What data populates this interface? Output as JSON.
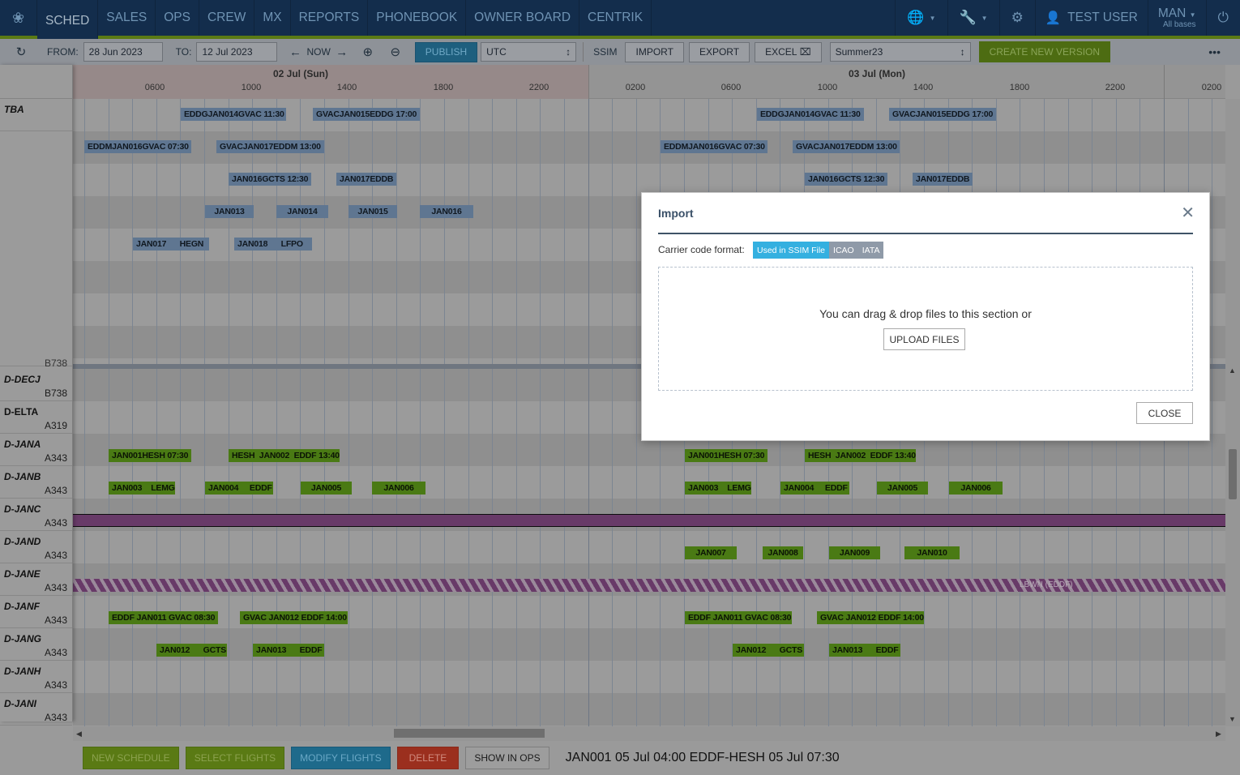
{
  "nav": {
    "items": [
      {
        "label": "SCHED",
        "active": true
      },
      {
        "label": "SALES"
      },
      {
        "label": "OPS"
      },
      {
        "label": "CREW"
      },
      {
        "label": "MX"
      },
      {
        "label": "REPORTS"
      },
      {
        "label": "PHONEBOOK"
      },
      {
        "label": "OWNER BOARD"
      },
      {
        "label": "CENTRIK"
      }
    ],
    "user": "TEST USER",
    "base": "MAN",
    "base_sub": "All bases",
    "icons": {
      "logo": "paw-icon",
      "globe": "globe-icon",
      "tools": "wrench-icon",
      "settings": "gear-icon",
      "user": "user-icon",
      "power": "power-icon"
    }
  },
  "toolbar": {
    "from_label": "FROM:",
    "from_value": "28 Jun 2023",
    "to_label": "TO:",
    "to_value": "12 Jul 2023",
    "now_label": "NOW",
    "publish_label": "PUBLISH",
    "timezone": "UTC",
    "ssim_label": "SSIM",
    "import_label": "IMPORT",
    "export_label": "EXPORT",
    "excel_label": "EXCEL",
    "version": "Summer23",
    "create_version_label": "CREATE NEW VERSION",
    "more_label": "•••"
  },
  "timeline": {
    "days": [
      "02 Jul (Sun)",
      "03 Jul (Mon)"
    ],
    "day1_ticks": [
      "0600",
      "1000",
      "1400",
      "1800",
      "2200"
    ],
    "day2_ticks": [
      "0200",
      "0600",
      "1000",
      "1400",
      "1800",
      "2200"
    ],
    "day3_ticks": [
      "0200"
    ]
  },
  "rows": [
    {
      "reg": "TBA",
      "type": ""
    },
    {
      "reg": "",
      "type": "B738"
    },
    {
      "reg": "D-DECJ",
      "type": "B738"
    },
    {
      "reg": "D-ELTA",
      "type": "A319"
    },
    {
      "reg": "D-JANA",
      "type": "A343"
    },
    {
      "reg": "D-JANB",
      "type": "A343"
    },
    {
      "reg": "D-JANC",
      "type": "A343"
    },
    {
      "reg": "D-JAND",
      "type": "A343"
    },
    {
      "reg": "D-JANE",
      "type": "A343"
    },
    {
      "reg": "D-JANF",
      "type": "A343"
    },
    {
      "reg": "D-JANG",
      "type": "A343"
    },
    {
      "reg": "D-JANH",
      "type": "A343"
    },
    {
      "reg": "D-JANI",
      "type": "A343"
    }
  ],
  "flights": {
    "tba": [
      "EDDGJAN014GVAC 11:30",
      "GVACJAN015EDDG 17:00",
      "EDDGJAN014GVAC 11:30",
      "GVACJAN015EDDG 17:00",
      "EDDMJAN016GVAC 07:30",
      "GVACJAN017EDDM 13:00",
      "EDDMJAN016GVAC 07:30",
      "GVACJAN017EDDM 13:00",
      "JAN016GCTS 12:30",
      "JAN017EDDB",
      "JAN016GCTS 12:30",
      "JAN017EDDB",
      "JAN013",
      "JAN014",
      "JAN015",
      "JAN016",
      "JAN017      HEGN",
      "JAN018      LFPO"
    ],
    "assigned": [
      "JAN001HESH 07:30",
      "HESH  JAN002  EDDF 13:40",
      "JAN001HESH 07:30",
      "HESH  JAN002  EDDF 13:40",
      "JAN003    LEMG",
      "JAN004     EDDF",
      "JAN005",
      "JAN006",
      "JAN003    LEMG",
      "JAN004     EDDF",
      "JAN005",
      "JAN006",
      "JAN007",
      "JAN008",
      "JAN009",
      "JAN010",
      "EDDF JAN011 GVAC 08:30",
      "GVAC JAN012 EDDF 14:00",
      "EDDF JAN011 GVAC 08:30",
      "GVAC JAN012 EDDF 14:00",
      "JAN012      GCTS",
      "JAN013      EDDF",
      "JAN012      GCTS",
      "JAN013      EDDF"
    ],
    "mx_label": "LBWN (EDDF)"
  },
  "bottom": {
    "new_schedule": "NEW SCHEDULE",
    "select_flights": "SELECT FLIGHTS",
    "modify_flights": "MODIFY FLIGHTS",
    "delete": "DELETE",
    "show_in_ops": "SHOW IN OPS",
    "status": "JAN001 05 Jul 04:00 EDDF-HESH 05 Jul 07:30"
  },
  "modal": {
    "title": "Import",
    "carrier_label": "Carrier code format:",
    "formats": [
      "Used in SSIM File",
      "ICAO",
      "IATA"
    ],
    "selected_format": "Used in SSIM File",
    "drop_text": "You can drag & drop files to this section or",
    "upload_label": "UPLOAD FILES",
    "close_label": "CLOSE"
  }
}
